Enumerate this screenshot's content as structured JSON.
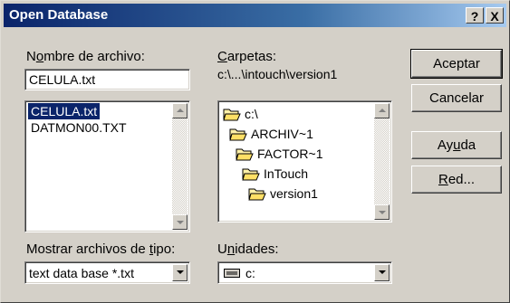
{
  "window": {
    "title": "Open Database",
    "help_button": "?",
    "close_button": "X"
  },
  "file_name": {
    "label_pre": "N",
    "label_accel": "o",
    "label_post": "mbre de archivo:",
    "value": "CELULA.txt"
  },
  "file_list": {
    "items": [
      "CELULA.txt",
      "DATMON00.TXT"
    ],
    "selected": "CELULA.txt"
  },
  "folders": {
    "label_accel": "C",
    "label_post": "arpetas:",
    "current_path": "c:\\...\\intouch\\version1",
    "tree": [
      {
        "name": "c:\\",
        "open": true
      },
      {
        "name": "ARCHIV~1",
        "open": true
      },
      {
        "name": "FACTOR~1",
        "open": true
      },
      {
        "name": "InTouch",
        "open": true
      },
      {
        "name": "version1",
        "open": true
      }
    ]
  },
  "file_type": {
    "label_pre": "Mostrar archivos de ",
    "label_accel": "t",
    "label_post": "ipo:",
    "value": "text data base *.txt"
  },
  "drives": {
    "label_pre": "U",
    "label_accel": "n",
    "label_post": "idades:",
    "value": "c:"
  },
  "buttons": {
    "accept": "Aceptar",
    "cancel": "Cancelar",
    "help_pre": "Ay",
    "help_accel": "u",
    "help_post": "da",
    "network_accel": "R",
    "network_post": "ed..."
  }
}
